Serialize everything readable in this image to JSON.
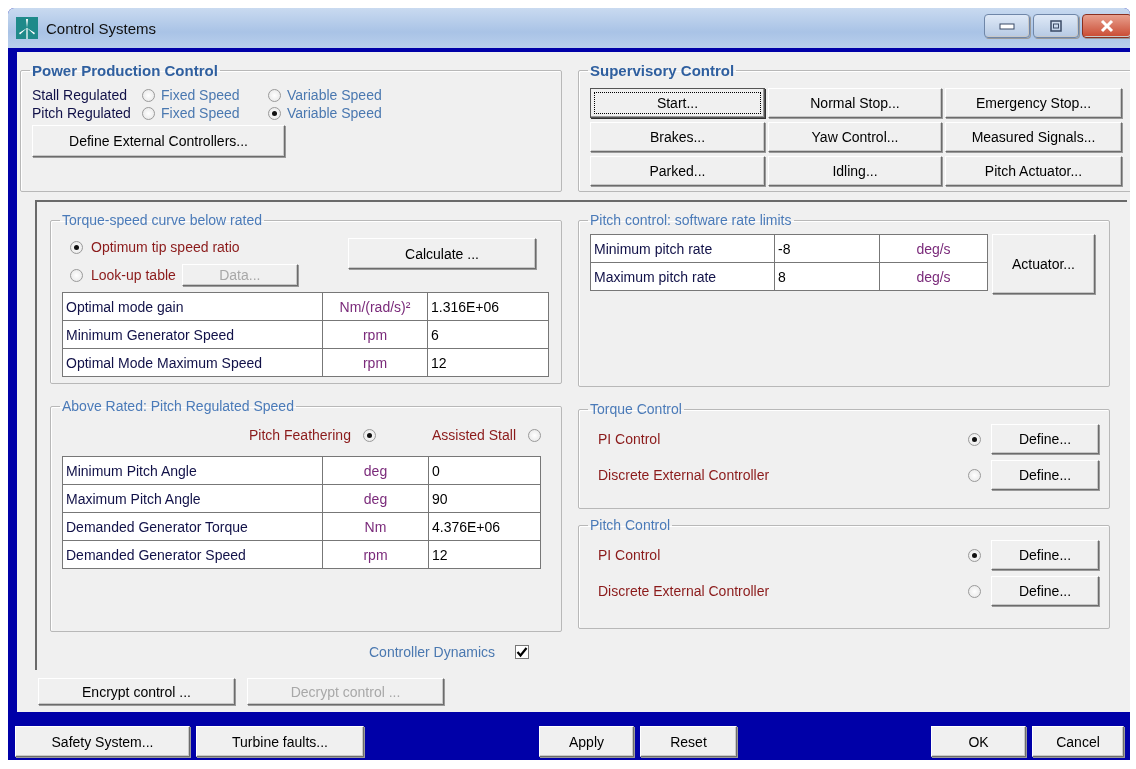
{
  "window": {
    "title": "Control Systems"
  },
  "power_production_control": {
    "title": "Power Production Control",
    "rows": [
      {
        "label": "Stall Regulated",
        "options": [
          {
            "label": "Fixed Speed",
            "selected": false
          },
          {
            "label": "Variable Speed",
            "selected": false
          }
        ]
      },
      {
        "label": "Pitch Regulated",
        "options": [
          {
            "label": "Fixed Speed",
            "selected": false
          },
          {
            "label": "Variable Speed",
            "selected": true
          }
        ]
      }
    ],
    "button": "Define External Controllers..."
  },
  "supervisory_control": {
    "title": "Supervisory Control",
    "buttons": [
      {
        "label": "Start...",
        "focused": true
      },
      {
        "label": "Normal Stop...",
        "focused": false
      },
      {
        "label": "Emergency Stop...",
        "focused": false
      },
      {
        "label": "Brakes...",
        "focused": false
      },
      {
        "label": "Yaw Control...",
        "focused": false
      },
      {
        "label": "Measured Signals...",
        "focused": false
      },
      {
        "label": "Parked...",
        "focused": false
      },
      {
        "label": "Idling...",
        "focused": false
      },
      {
        "label": "Pitch Actuator...",
        "focused": false
      }
    ]
  },
  "torque_speed_curve": {
    "title": "Torque-speed curve below rated",
    "options": [
      {
        "label": "Optimum tip speed ratio",
        "selected": true
      },
      {
        "label": "Look-up table",
        "selected": false
      }
    ],
    "data_button": {
      "label": "Data...",
      "disabled": true
    },
    "calculate_button": "Calculate ...",
    "rows": [
      {
        "name": "Optimal mode gain",
        "unit": "Nm/(rad/s)²",
        "value": "1.316E+06"
      },
      {
        "name": "Minimum Generator Speed",
        "unit": "rpm",
        "value": "6"
      },
      {
        "name": "Optimal Mode Maximum Speed",
        "unit": "rpm",
        "value": "12"
      }
    ]
  },
  "pitch_rate_limits": {
    "title": "Pitch control: software rate limits",
    "rows": [
      {
        "name": "Minimum pitch rate",
        "value": "-8",
        "unit": "deg/s"
      },
      {
        "name": "Maximum pitch rate",
        "value": "8",
        "unit": "deg/s"
      }
    ],
    "button": "Actuator..."
  },
  "above_rated": {
    "title": "Above Rated: Pitch Regulated Speed",
    "options": [
      {
        "label": "Pitch Feathering",
        "selected": true
      },
      {
        "label": "Assisted Stall",
        "selected": false
      }
    ],
    "rows": [
      {
        "name": "Minimum Pitch Angle",
        "unit": "deg",
        "value": "0"
      },
      {
        "name": "Maximum Pitch Angle",
        "unit": "deg",
        "value": "90"
      },
      {
        "name": "Demanded Generator Torque",
        "unit": "Nm",
        "value": "4.376E+06"
      },
      {
        "name": "Demanded Generator Speed",
        "unit": "rpm",
        "value": "12"
      }
    ]
  },
  "torque_control": {
    "title": "Torque Control",
    "options": [
      {
        "label": "PI Control",
        "selected": true,
        "button": "Define..."
      },
      {
        "label": "Discrete External Controller",
        "selected": false,
        "button": "Define..."
      }
    ]
  },
  "pitch_control": {
    "title": "Pitch Control",
    "options": [
      {
        "label": "PI Control",
        "selected": true,
        "button": "Define..."
      },
      {
        "label": "Discrete External Controller",
        "selected": false,
        "button": "Define..."
      }
    ]
  },
  "controller_dynamics": {
    "label": "Controller Dynamics",
    "checked": true
  },
  "encryption_buttons": [
    {
      "label": "Encrypt control ...",
      "disabled": false
    },
    {
      "label": "Decrypt control ...",
      "disabled": true
    }
  ],
  "footer": {
    "left": [
      "Safety System...",
      "Turbine faults..."
    ],
    "center": [
      "Apply",
      "Reset"
    ],
    "right": [
      "OK",
      "Cancel"
    ]
  }
}
